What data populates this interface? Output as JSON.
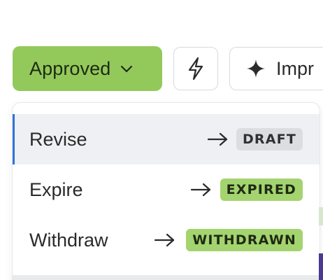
{
  "toolbar": {
    "status_label": "Approved",
    "status_color": "#93c95a",
    "status_icon": "chevron-down-icon",
    "quick_action_icon": "lightning-bolt-icon",
    "improve_label": "Impr",
    "improve_icon": "sparkle-icon"
  },
  "menu": {
    "items": [
      {
        "label": "Revise",
        "arrow": "arrow-right-icon",
        "target": "DRAFT",
        "target_color": "#dcdde0",
        "active": true
      },
      {
        "label": "Expire",
        "arrow": "arrow-right-icon",
        "target": "EXPIRED",
        "target_color": "#a4d46f",
        "active": false
      },
      {
        "label": "Withdraw",
        "arrow": "arrow-right-icon",
        "target": "WITHDRAWN",
        "target_color": "#a4d46f",
        "active": false
      }
    ],
    "active_indicator_color": "#2e73d8"
  }
}
